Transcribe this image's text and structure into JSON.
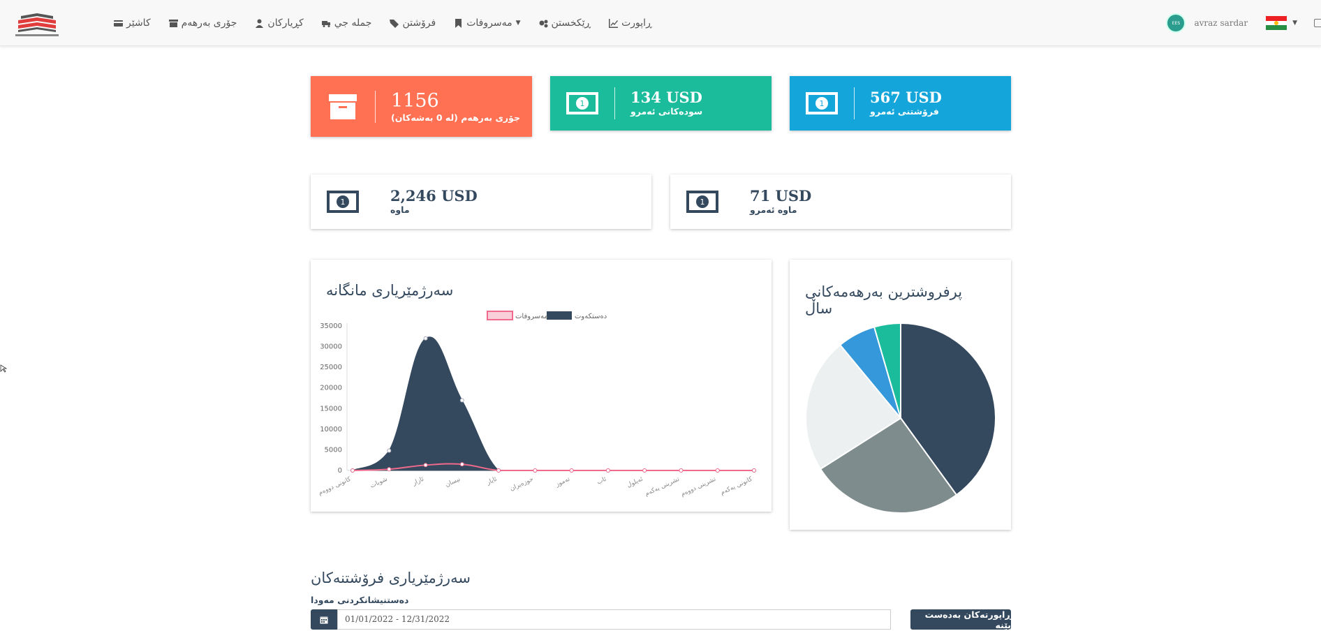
{
  "nav": {
    "items": [
      {
        "label": "کاشێر",
        "icon": "credit-card-icon"
      },
      {
        "label": "جۆری بەرهەم",
        "icon": "archive-icon"
      },
      {
        "label": "کڕیارکان",
        "icon": "user-icon"
      },
      {
        "label": "جملە جي",
        "icon": "truck-icon"
      },
      {
        "label": "فرۆشتن",
        "icon": "tag-icon"
      },
      {
        "label": "مەسروفات",
        "icon": "bookmark-icon"
      },
      {
        "label": "ڕێکخستن",
        "icon": "cogs-icon"
      },
      {
        "label": "ڕاپورت",
        "icon": "line-chart-icon"
      }
    ],
    "user_name": "avraz sardar",
    "flag_colors": [
      "#ed2024",
      "#ffffff",
      "#278e43"
    ],
    "sun_color": "#febd11"
  },
  "stats": {
    "products": {
      "value": "1156",
      "label": "جۆری بەرهەم (لە 0 بەشەکان)",
      "color": "#ff7152"
    },
    "profit_today": {
      "value": "134 USD",
      "label": "سودەکانی ئەمرو",
      "color": "#1abc9c"
    },
    "sales_today": {
      "value": "567 USD",
      "label": "فرۆشتنی ئەمرو",
      "color": "#14a5db"
    },
    "remaining": {
      "value": "2,246 USD",
      "label": "ماوە"
    },
    "remaining_today": {
      "value": "71 USD",
      "label": "ماوە ئەمرو"
    }
  },
  "monthly_panel": {
    "title": "سەرژمێریاری مانگانە"
  },
  "pie_panel": {
    "title_line1": "پرفروشترین بەرهەمەکانی",
    "title_line2": "ساڵ"
  },
  "chart_data": [
    {
      "type": "area",
      "title": "سەرژمێریاری مانگانە",
      "categories": [
        "کانونی دووەم",
        "شوبات",
        "ئازار",
        "نیسان",
        "ئایار",
        "حوزەیران",
        "تەموز",
        "ئاب",
        "ئەیلول",
        "تشرینی یەکەم",
        "تشرینی دووەم",
        "کانونی یەکەم"
      ],
      "series": [
        {
          "name": "دەستکەوت",
          "values": [
            0,
            4800,
            32000,
            17000,
            0,
            0,
            0,
            0,
            0,
            0,
            0,
            0
          ],
          "color": "#34495e"
        },
        {
          "name": "مەسروفات",
          "values": [
            0,
            300,
            1300,
            1500,
            0,
            0,
            0,
            0,
            0,
            0,
            0,
            0
          ],
          "color": "#f06a8c"
        }
      ],
      "ylim": [
        0,
        35000
      ],
      "yticks": [
        0,
        5000,
        10000,
        15000,
        20000,
        25000,
        30000,
        35000
      ],
      "legend": "top"
    },
    {
      "type": "pie",
      "values": [
        40,
        26,
        23,
        6.5,
        4.5
      ],
      "colors": [
        "#34495e",
        "#7f8c8d",
        "#ecf0f1",
        "#3498db",
        "#1abc9c"
      ]
    }
  ],
  "sales_section": {
    "title": "سەرژمێریاری فرۆشتنەکان",
    "range_label": "دەستنیشانکردنی مەودا",
    "range_value": "01/01/2022 - 12/31/2022",
    "report_button": "ڕاپورتەکان بەدەست بێنە"
  }
}
